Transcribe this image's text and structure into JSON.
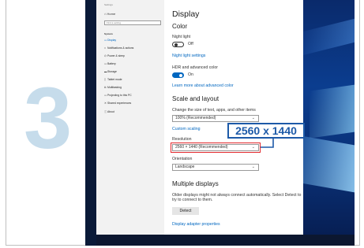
{
  "step_number": "3",
  "sidebar": {
    "title": "Settings",
    "home_label": "Home",
    "search_placeholder": "Find a setting",
    "section_label": "System",
    "items": [
      {
        "label": "Display",
        "icon": "monitor-icon",
        "active": true
      },
      {
        "label": "Notifications & actions",
        "icon": "notification-icon",
        "active": false
      },
      {
        "label": "Power & sleep",
        "icon": "power-icon",
        "active": false
      },
      {
        "label": "Battery",
        "icon": "battery-icon",
        "active": false
      },
      {
        "label": "Storage",
        "icon": "storage-icon",
        "active": false
      },
      {
        "label": "Tablet mode",
        "icon": "tablet-icon",
        "active": false
      },
      {
        "label": "Multitasking",
        "icon": "multitasking-icon",
        "active": false
      },
      {
        "label": "Projecting to this PC",
        "icon": "projecting-icon",
        "active": false
      },
      {
        "label": "Shared experiences",
        "icon": "shared-icon",
        "active": false
      },
      {
        "label": "About",
        "icon": "info-icon",
        "active": false
      }
    ]
  },
  "display": {
    "title": "Display",
    "color_heading": "Color",
    "night_light_label": "Night light",
    "night_light_state": "Off",
    "night_light_settings_link": "Night light settings",
    "hdr_label": "HDR and advanced color",
    "hdr_state": "On",
    "advanced_color_link": "Learn more about advanced color",
    "scale_heading": "Scale and layout",
    "scale_label": "Change the size of text, apps, and other items",
    "scale_value": "100% (Recommended)",
    "custom_scaling_link": "Custom scaling",
    "resolution_label": "Resolution",
    "resolution_value": "2560 × 1440 (Recommended)",
    "orientation_label": "Orientation",
    "orientation_value": "Landscape",
    "multiple_heading": "Multiple displays",
    "multiple_text": "Older displays might not always connect automatically. Select Detect to try to connect to them.",
    "detect_button": "Detect",
    "adapter_link": "Display adapter properties"
  },
  "callout": {
    "text": "2560 x 1440",
    "color": "#1d5aa8",
    "highlight_color": "#e2262b"
  },
  "colors": {
    "accent": "#0067c0",
    "sidebar_bg": "#f2f2f2",
    "wallpaper": "#0b3d8f"
  }
}
